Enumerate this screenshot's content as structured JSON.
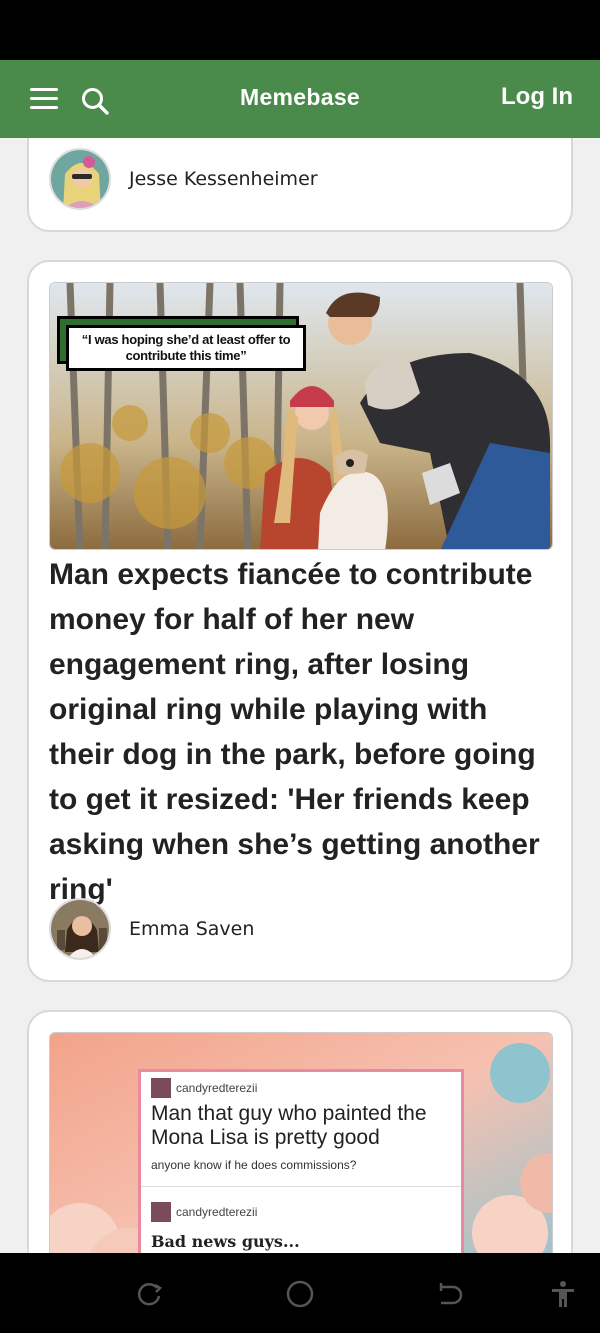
{
  "header": {
    "brand": "Memebase",
    "login_label": "Log In"
  },
  "colors": {
    "header_bg": "#4a8a4a",
    "card_border": "#d8d8d8",
    "quote_accent": "#2f6e2f",
    "tumblr_border": "#e88aa0"
  },
  "icons": {
    "menu": "hamburger-menu-icon",
    "search": "search-icon",
    "recents": "recent-apps-icon",
    "home": "home-icon",
    "back": "back-icon",
    "accessibility": "accessibility-icon"
  },
  "feed": {
    "card1": {
      "author": "Jesse Kessenheimer"
    },
    "card2": {
      "image_quote": "“I was hoping she’d at least offer to contribute this time”",
      "headline": "Man expects fiancée to contribute money for half of her new engagement ring, after losing original ring while playing with their dog in the park, before going to get it resized: 'Her friends keep asking when she’s getting another ring'",
      "author": "Emma Saven"
    },
    "card3": {
      "post_user_1": "candyredterezii",
      "post_title": "Man that guy who painted the Mona Lisa is pretty good",
      "post_sub": "anyone know if he does commissions?",
      "post_user_2": "candyredterezii",
      "post_reply": "Bad news guys..."
    }
  }
}
